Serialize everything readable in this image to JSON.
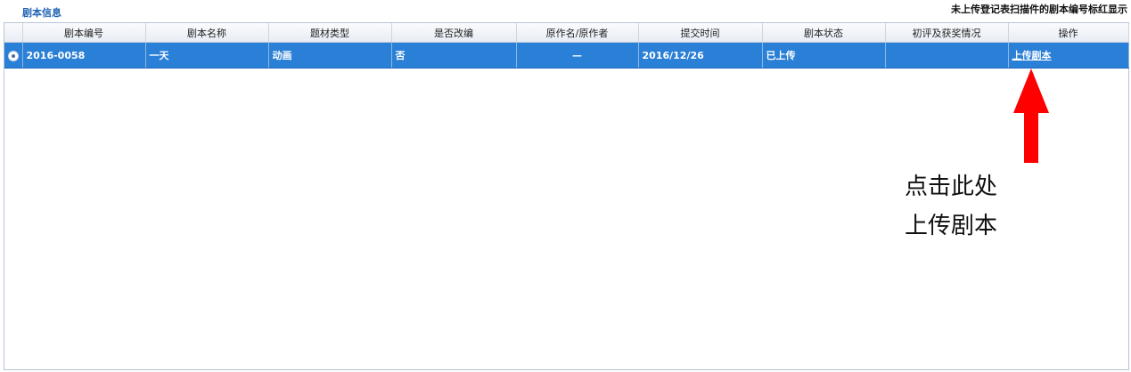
{
  "panel": {
    "title": "剧本信息",
    "note": "未上传登记表扫描件的剧本编号标红显示"
  },
  "table": {
    "columns": [
      "剧本编号",
      "剧本名称",
      "题材类型",
      "是否改编",
      "原作名/原作者",
      "提交时间",
      "剧本状态",
      "初评及获奖情况",
      "操作"
    ],
    "rows": [
      {
        "selected": true,
        "script_no": "2016-0058",
        "script_name": "一天",
        "genre": "动画",
        "adapted": "否",
        "original": "—",
        "submit_time": "2016/12/26",
        "status": "已上传",
        "evaluation": "",
        "action_label": "上传剧本"
      }
    ]
  },
  "callout": {
    "line1": "点击此处",
    "line2": "上传剧本"
  },
  "colors": {
    "selected_row": "#2a7fd6",
    "title_blue": "#1f63b4",
    "arrow_red": "#ff0000"
  }
}
